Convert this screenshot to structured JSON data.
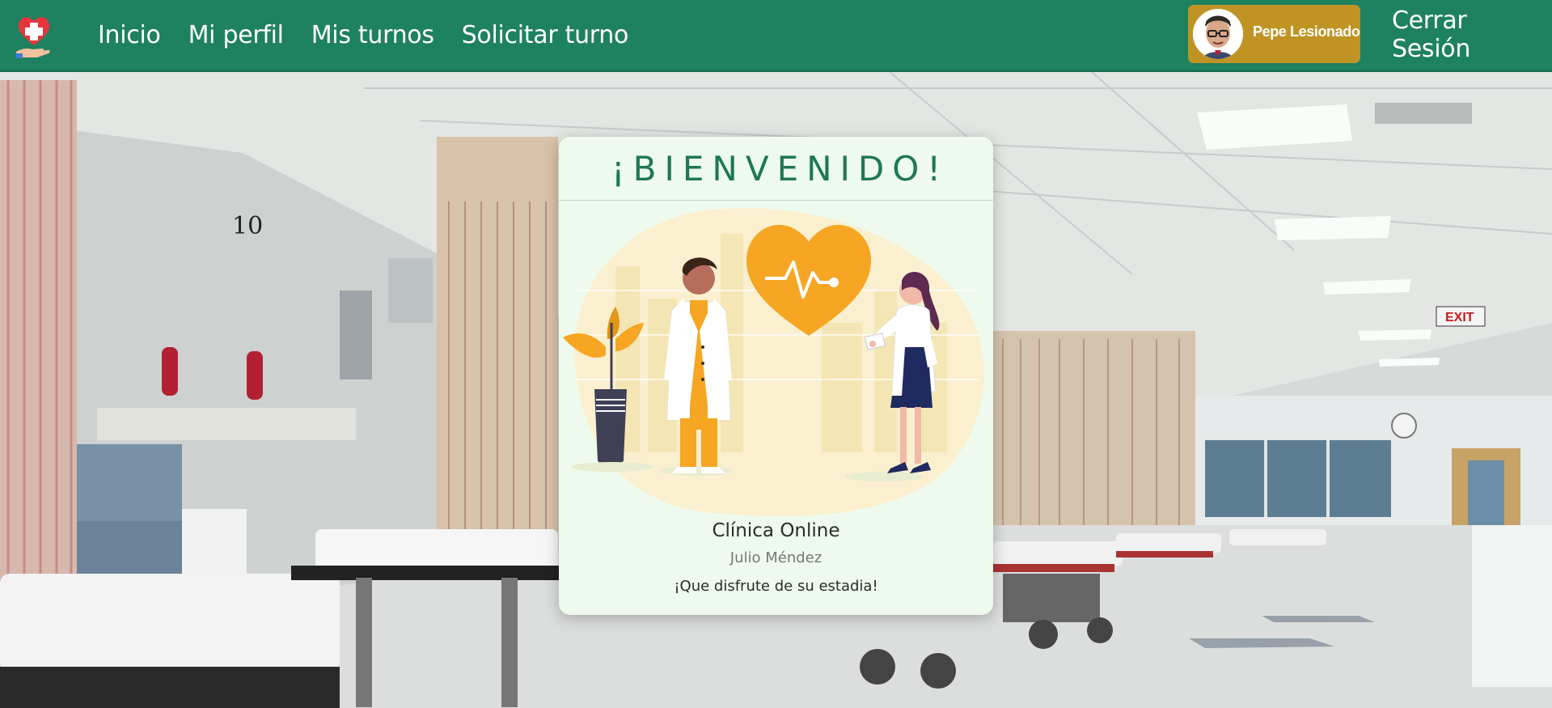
{
  "navbar": {
    "logo_icon": "medical-cross-heart-hand-icon",
    "links": [
      {
        "label": "Inicio"
      },
      {
        "label": "Mi perfil"
      },
      {
        "label": "Mis turnos"
      },
      {
        "label": "Solicitar turno"
      }
    ],
    "user": {
      "name": "Pepe Lesionado",
      "avatar_icon": "user-avatar-icon"
    },
    "logout_label": "Cerrar Sesión",
    "colors": {
      "bar": "#1e8160",
      "user_chip": "#c09424"
    }
  },
  "welcome_card": {
    "title": "¡BIENVENIDO!",
    "illustration": "doctors-heart-illustration",
    "clinic_name": "Clínica Online",
    "doctor_name": "Julio Méndez",
    "greeting": "¡Que disfrute de su estadia!",
    "colors": {
      "title": "#1e7755",
      "accent": "#f6a623",
      "background": "#eefaee"
    }
  },
  "background": {
    "scene": "hospital-ward-photo"
  }
}
